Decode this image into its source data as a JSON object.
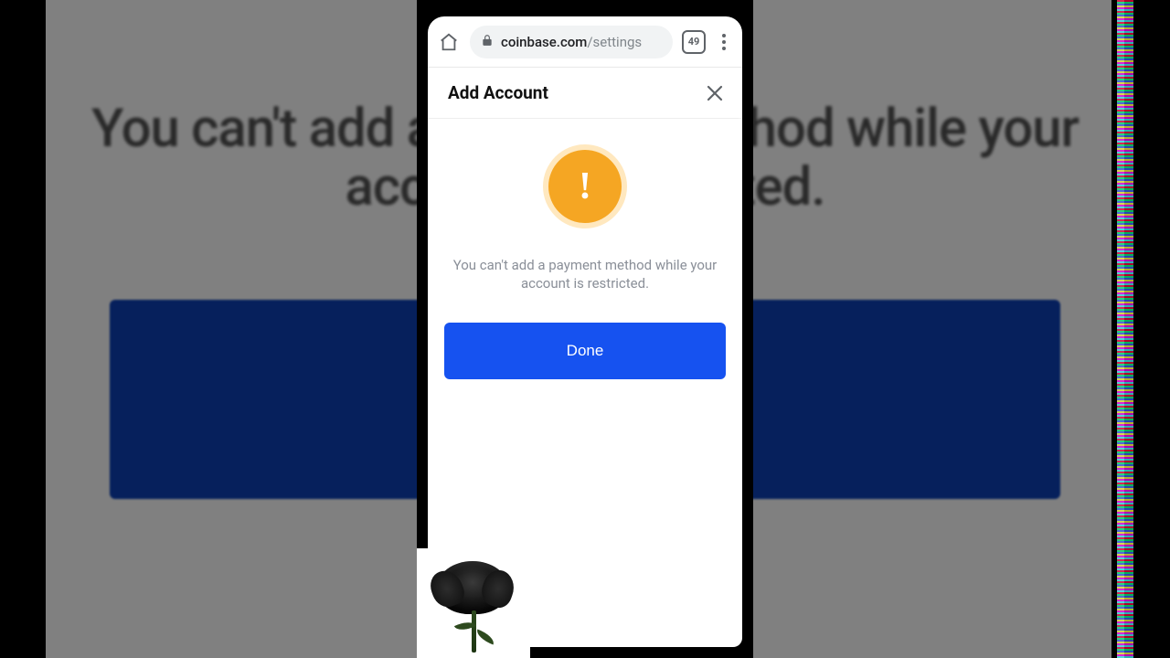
{
  "background": {
    "large_text": "You can't add a payment method while your account is restricted."
  },
  "browser": {
    "url_host": "coinbase.com",
    "url_path": "/settings",
    "tab_count": "49"
  },
  "modal": {
    "title": "Add Account",
    "message": "You can't add a payment method while your account is restricted.",
    "done_label": "Done"
  }
}
